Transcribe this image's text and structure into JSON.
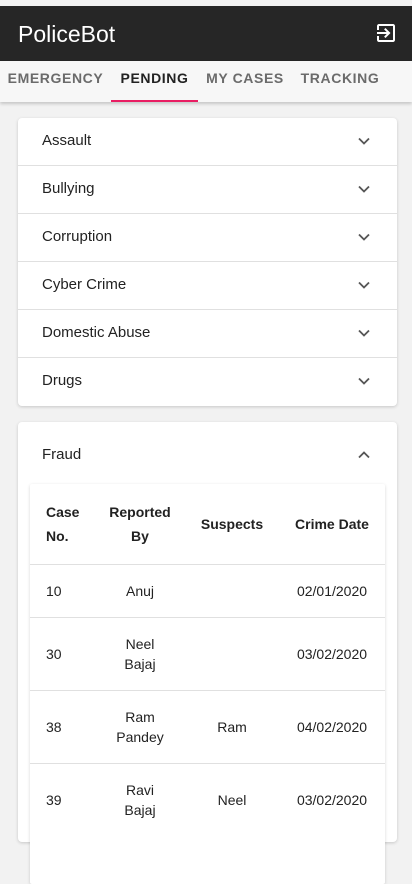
{
  "app": {
    "title": "PoliceBot",
    "exit_icon": "exit-to-app-icon"
  },
  "tabs": [
    {
      "label": "EMERGENCY",
      "active": false
    },
    {
      "label": "PENDING",
      "active": true
    },
    {
      "label": "MY CASES",
      "active": false
    },
    {
      "label": "TRACKING",
      "active": false
    }
  ],
  "categories": [
    {
      "label": "Assault",
      "expanded": false
    },
    {
      "label": "Bullying",
      "expanded": false
    },
    {
      "label": "Corruption",
      "expanded": false
    },
    {
      "label": "Cyber Crime",
      "expanded": false
    },
    {
      "label": "Domestic Abuse",
      "expanded": false
    },
    {
      "label": "Drugs",
      "expanded": false
    }
  ],
  "fraud": {
    "label": "Fraud",
    "expanded": true,
    "table": {
      "headers": {
        "case_no": [
          "Case",
          "No."
        ],
        "reported_by": [
          "Reported",
          "By"
        ],
        "suspects": "Suspects",
        "crime_date": "Crime Date"
      },
      "rows": [
        {
          "case_no": "10",
          "reported_by": [
            "Anuj"
          ],
          "suspects": "",
          "crime_date": "02/01/2020"
        },
        {
          "case_no": "30",
          "reported_by": [
            "Neel",
            "Bajaj"
          ],
          "suspects": "",
          "crime_date": "03/02/2020"
        },
        {
          "case_no": "38",
          "reported_by": [
            "Ram",
            "Pandey"
          ],
          "suspects": "Ram",
          "crime_date": "04/02/2020"
        },
        {
          "case_no": "39",
          "reported_by": [
            "Ravi",
            "Bajaj"
          ],
          "suspects": "Neel",
          "crime_date": "03/02/2020"
        }
      ]
    }
  },
  "colors": {
    "appbar": "#262626",
    "accent": "#e91e63",
    "background": "#f2f2f2"
  }
}
